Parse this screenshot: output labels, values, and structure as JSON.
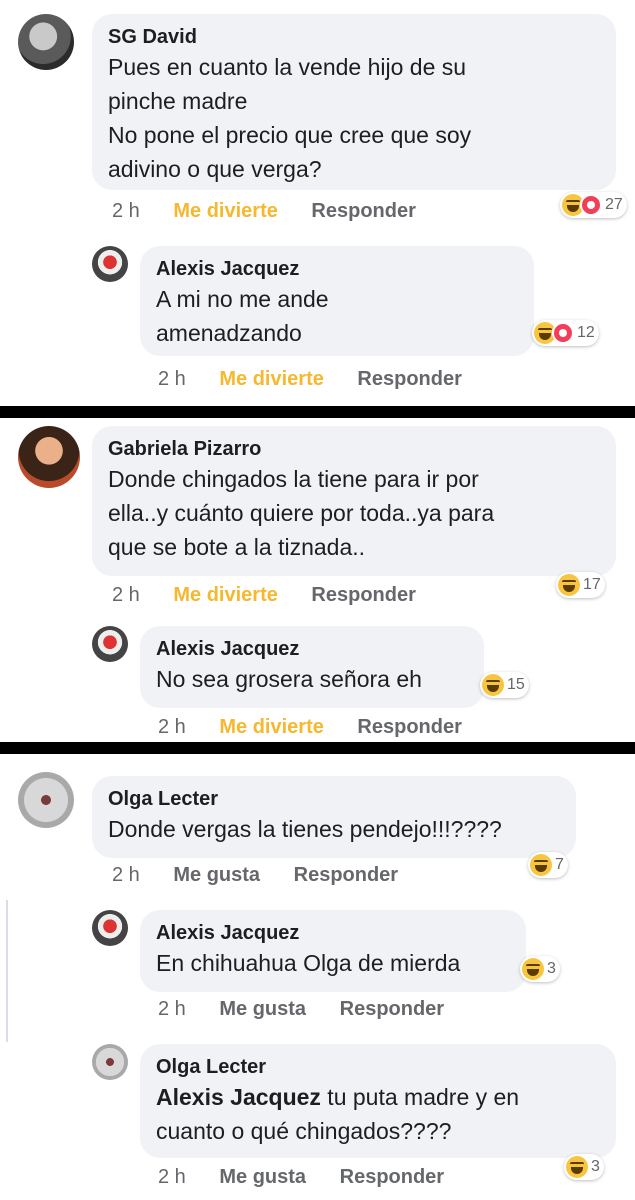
{
  "sections": [
    {
      "comment": {
        "author": "SG David",
        "lines": [
          "Pues en cuanto la vende hijo de su",
          "pinche madre",
          "No pone el precio que cree que soy",
          "adivino o que verga?"
        ],
        "time": "2 h",
        "like": "Me divierte",
        "reply": "Responder",
        "reactions": [
          "haha",
          "love"
        ],
        "reaction_count": "27"
      },
      "reply": {
        "author": "Alexis Jacquez",
        "lines": [
          "A mi no me ande",
          "amenadzando"
        ],
        "time": "2 h",
        "like": "Me divierte",
        "reply": "Responder",
        "reactions": [
          "haha",
          "love"
        ],
        "reaction_count": "12"
      }
    },
    {
      "comment": {
        "author": "Gabriela Pizarro",
        "lines": [
          "Donde chingados la tiene para ir por",
          "ella..y cuánto quiere por toda..ya para",
          "que se bote a la tiznada.."
        ],
        "time": "2 h",
        "like": "Me divierte",
        "reply": "Responder",
        "reactions": [
          "haha"
        ],
        "reaction_count": "17"
      },
      "reply": {
        "author": "Alexis Jacquez",
        "lines": [
          "No sea grosera señora eh"
        ],
        "time": "2 h",
        "like": "Me divierte",
        "reply": "Responder",
        "reactions": [
          "haha"
        ],
        "reaction_count": "15"
      }
    },
    {
      "comment": {
        "author": "Olga Lecter",
        "lines": [
          "Donde vergas la tienes pendejo!!!????"
        ],
        "time": "2 h",
        "like": "Me gusta",
        "reply": "Responder",
        "reactions": [
          "haha"
        ],
        "reaction_count": "7"
      },
      "reply": {
        "author": "Alexis Jacquez",
        "lines": [
          "En chihuahua Olga de mierda"
        ],
        "time": "2 h",
        "like": "Me gusta",
        "reply": "Responder",
        "reactions": [
          "haha"
        ],
        "reaction_count": "3"
      },
      "reply2": {
        "author": "Olga Lecter",
        "mention": "Alexis Jacquez",
        "line1_rest": " tu puta madre y en",
        "line2": "cuanto o qué chingados????",
        "time": "2 h",
        "like": "Me gusta",
        "reply": "Responder",
        "reactions": [
          "haha"
        ],
        "reaction_count": "3"
      }
    }
  ],
  "colors": {
    "bubble": "#f0f2f5",
    "reacted_link": "#f5b82e",
    "meta_text": "#65676b",
    "divider": "#000000"
  }
}
